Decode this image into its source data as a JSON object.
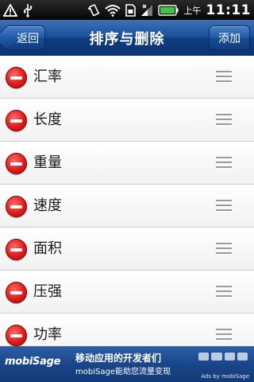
{
  "status_bar": {
    "ampm": "上午",
    "time": "11:11",
    "icons": [
      "warning-icon",
      "usb-icon",
      "vibrate-icon",
      "wifi-icon",
      "sdcard-icon",
      "signal-icon",
      "battery-icon"
    ]
  },
  "header": {
    "back_label": "返回",
    "title": "排序与删除",
    "add_label": "添加"
  },
  "list": {
    "items": [
      {
        "label": "汇率"
      },
      {
        "label": "长度"
      },
      {
        "label": "重量"
      },
      {
        "label": "速度"
      },
      {
        "label": "面积"
      },
      {
        "label": "压强"
      },
      {
        "label": "功率"
      }
    ]
  },
  "ad": {
    "logo": "mobiSage",
    "headline": "移动应用的开发者们",
    "subline": "mobiSage能助您流量变现",
    "by": "Ads by mobiSage"
  },
  "colors": {
    "title_bar": "#1a4f98",
    "delete_red": "#e01b1b",
    "ad_bg": "#1a468a"
  }
}
